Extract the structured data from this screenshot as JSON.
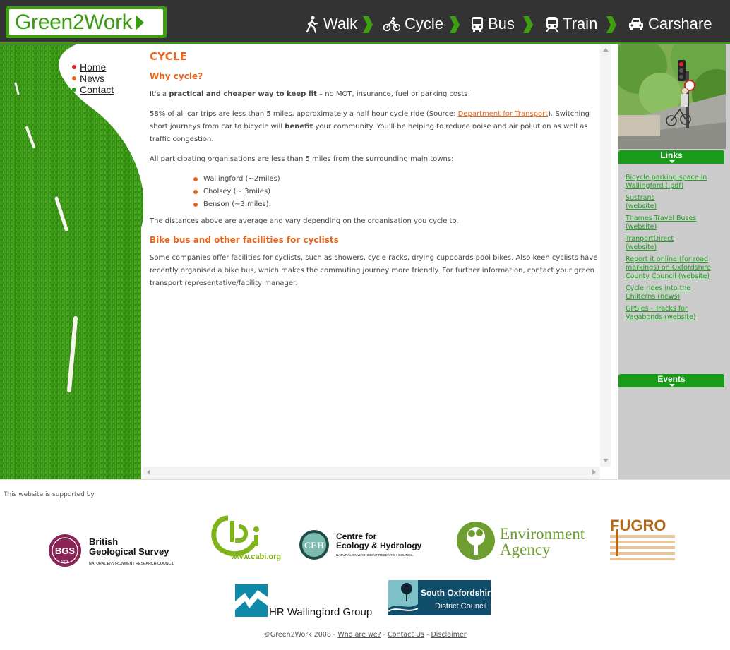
{
  "header": {
    "logo_text": "Green2Work",
    "nav": [
      {
        "label": "Walk",
        "icon": "walk-icon"
      },
      {
        "label": "Cycle",
        "icon": "bicycle-icon"
      },
      {
        "label": "Bus",
        "icon": "bus-icon"
      },
      {
        "label": "Train",
        "icon": "train-icon"
      },
      {
        "label": "Carshare",
        "icon": "car-icon"
      }
    ]
  },
  "sidebar": {
    "items": [
      {
        "label": "Home",
        "color": "#d62020"
      },
      {
        "label": "News",
        "color": "#e8651b"
      },
      {
        "label": "Contact",
        "color": "#22a022"
      }
    ]
  },
  "main": {
    "title": "CYCLE",
    "why_heading": "Why cycle?",
    "p1_prefix": "It's a ",
    "p1_bold": "practical and cheaper way to keep fit",
    "p1_suffix": " – no MOT, insurance, fuel or parking costs!",
    "p2_prefix": "58% of all car trips are less than 5 miles, approximately a half hour cycle ride (Source: ",
    "p2_link": "Department for Transport",
    "p2_mid": ").  Switching short journeys from car to bicycle will ",
    "p2_bold": "benefit",
    "p2_suffix": " your community. You'll be helping to reduce noise and air pollution as well as traffic congestion.",
    "p3": "All participating organisations are less than 5 miles from the surrounding main towns:",
    "towns": [
      "Wallingford (~2miles)",
      "Cholsey (~ 3miles)",
      "Benson (~3 miles)."
    ],
    "p4": "The distances above are average and vary depending on the organisation you cycle to.",
    "bike_heading": "Bike bus and other facilities for cyclists",
    "p5": "Some companies offer facilities for cyclists, such as showers, cycle racks, drying cupboards pool bikes. Also keen cyclists have recently organised a bike bus, which makes the commuting journey more friendly. For further information, contact your green transport representative/facility manager."
  },
  "rightcol": {
    "links_heading": "Links",
    "events_heading": "Events",
    "links": [
      "Bicycle parking space in Wallingford (.pdf)",
      "Sustrans (website)",
      "Thames Travel Buses (website)",
      "TranportDirect (website)",
      "Report it online (for road markings) on Oxfordshire County Council (website)",
      "Cycle rides into the Chilterns (news)",
      "GPSies - Tracks for Vagabonds (website)"
    ]
  },
  "footer": {
    "supported": "This website is supported by:",
    "bgs_line1": "British",
    "bgs_line2": "Geological Survey",
    "bgs_line3": "NATURAL ENVIRONMENT RESEARCH COUNCIL",
    "bgs_badge": "BGS",
    "bgs_year": "1835",
    "cabi_url": "www.cabi.org",
    "ceh_badge": "CEH",
    "ceh_line1": "Centre for",
    "ceh_line2": "Ecology & Hydrology",
    "ceh_line3": "NATURAL ENVIRONMENT RESEARCH COUNCIL",
    "ea_line1": "Environment",
    "ea_line2": "Agency",
    "fugro": "FUGRO",
    "hr": "HR Wallingford Group",
    "so_line1": "South Oxfordshire",
    "so_line2": "District Council",
    "copyright": "©Green2Work 2008 - ",
    "who": "Who are we?",
    "sep1": " - ",
    "contact": "Contact Us",
    "sep2": " - ",
    "disclaimer": "Disclaimer"
  }
}
